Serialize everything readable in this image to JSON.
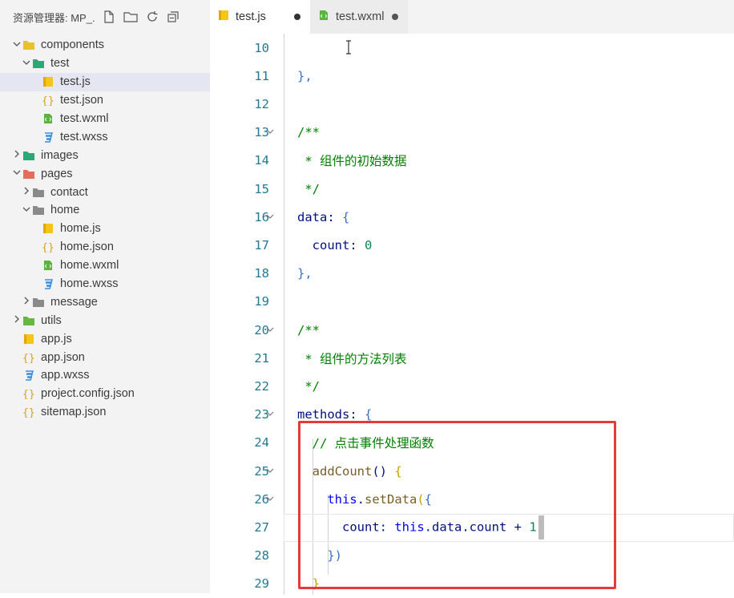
{
  "sidebar": {
    "title": "资源管理器: MP_...",
    "items": [
      {
        "label": "components",
        "type": "folder",
        "open": true,
        "icon": "components-folder-icon",
        "color": "#e8c22a"
      },
      {
        "label": "test",
        "type": "folder",
        "open": true,
        "icon": "test-folder-icon",
        "color": "#2aa876"
      },
      {
        "label": "test.js",
        "type": "js",
        "icon": "js-file-icon",
        "selected": true
      },
      {
        "label": "test.json",
        "type": "json",
        "icon": "json-file-icon"
      },
      {
        "label": "test.wxml",
        "type": "wxml",
        "icon": "wxml-file-icon"
      },
      {
        "label": "test.wxss",
        "type": "wxss",
        "icon": "wxss-file-icon"
      },
      {
        "label": "images",
        "type": "folder",
        "open": false,
        "icon": "images-folder-icon",
        "color": "#2aa876"
      },
      {
        "label": "pages",
        "type": "folder",
        "open": true,
        "icon": "pages-folder-icon",
        "color": "#e56b5b"
      },
      {
        "label": "contact",
        "type": "folder",
        "open": false,
        "icon": "contact-folder-icon",
        "color": "#8a8a8a"
      },
      {
        "label": "home",
        "type": "folder",
        "open": true,
        "icon": "home-folder-icon",
        "color": "#8a8a8a"
      },
      {
        "label": "home.js",
        "type": "js",
        "icon": "js-file-icon"
      },
      {
        "label": "home.json",
        "type": "json",
        "icon": "json-file-icon"
      },
      {
        "label": "home.wxml",
        "type": "wxml",
        "icon": "wxml-file-icon"
      },
      {
        "label": "home.wxss",
        "type": "wxss",
        "icon": "wxss-file-icon"
      },
      {
        "label": "message",
        "type": "folder",
        "open": false,
        "icon": "message-folder-icon",
        "color": "#8a8a8a"
      },
      {
        "label": "utils",
        "type": "folder",
        "open": false,
        "icon": "utils-folder-icon",
        "color": "#6bb544"
      },
      {
        "label": "app.js",
        "type": "js",
        "icon": "js-file-icon"
      },
      {
        "label": "app.json",
        "type": "json",
        "icon": "json-file-icon"
      },
      {
        "label": "app.wxss",
        "type": "wxss",
        "icon": "wxss-file-icon"
      },
      {
        "label": "project.config.json",
        "type": "json",
        "icon": "json-file-icon"
      },
      {
        "label": "sitemap.json",
        "type": "json",
        "icon": "json-file-icon"
      }
    ]
  },
  "tabs": [
    {
      "label": "test.js",
      "active": true,
      "dirty": true
    },
    {
      "label": "test.wxml",
      "active": false,
      "dirty": true
    }
  ],
  "editor": {
    "lines": [
      {
        "n": "10",
        "fold": false,
        "parts": []
      },
      {
        "n": "11",
        "fold": false,
        "parts": [
          {
            "t": "},",
            "c": "punc"
          }
        ]
      },
      {
        "n": "12",
        "fold": false,
        "parts": []
      },
      {
        "n": "13",
        "fold": true,
        "parts": [
          {
            "t": "/**",
            "c": "comment"
          }
        ]
      },
      {
        "n": "14",
        "fold": false,
        "parts": [
          {
            "t": " * 组件的初始数据",
            "c": "comment"
          }
        ]
      },
      {
        "n": "15",
        "fold": false,
        "parts": [
          {
            "t": " */",
            "c": "comment"
          }
        ]
      },
      {
        "n": "16",
        "fold": true,
        "parts": [
          {
            "t": "data",
            "c": "key"
          },
          {
            "t": ": ",
            "c": "key"
          },
          {
            "t": "{",
            "c": "punc"
          }
        ]
      },
      {
        "n": "17",
        "fold": false,
        "parts": [
          {
            "t": "  count",
            "c": "key"
          },
          {
            "t": ": ",
            "c": "key"
          },
          {
            "t": "0",
            "c": "num"
          }
        ]
      },
      {
        "n": "18",
        "fold": false,
        "parts": [
          {
            "t": "},",
            "c": "punc"
          }
        ]
      },
      {
        "n": "19",
        "fold": false,
        "parts": []
      },
      {
        "n": "20",
        "fold": true,
        "parts": [
          {
            "t": "/**",
            "c": "comment"
          }
        ]
      },
      {
        "n": "21",
        "fold": false,
        "parts": [
          {
            "t": " * 组件的方法列表",
            "c": "comment"
          }
        ]
      },
      {
        "n": "22",
        "fold": false,
        "parts": [
          {
            "t": " */",
            "c": "comment"
          }
        ]
      },
      {
        "n": "23",
        "fold": true,
        "parts": [
          {
            "t": "methods",
            "c": "key"
          },
          {
            "t": ": ",
            "c": "key"
          },
          {
            "t": "{",
            "c": "punc"
          }
        ]
      },
      {
        "n": "24",
        "fold": false,
        "parts": [
          {
            "t": "  // 点击事件处理函数",
            "c": "comment"
          }
        ]
      },
      {
        "n": "25",
        "fold": true,
        "parts": [
          {
            "t": "  addCount",
            "c": "fn"
          },
          {
            "t": "() ",
            "c": "key"
          },
          {
            "t": "{",
            "c": "yellow"
          }
        ]
      },
      {
        "n": "26",
        "fold": true,
        "parts": [
          {
            "t": "    this",
            "c": "this"
          },
          {
            "t": ".",
            "c": "key"
          },
          {
            "t": "setData",
            "c": "fn"
          },
          {
            "t": "(",
            "c": "yellow"
          },
          {
            "t": "{",
            "c": "punc"
          }
        ]
      },
      {
        "n": "27",
        "fold": false,
        "parts": [
          {
            "t": "      count",
            "c": "key"
          },
          {
            "t": ": ",
            "c": "key"
          },
          {
            "t": "this",
            "c": "this"
          },
          {
            "t": ".data.count + ",
            "c": "key"
          },
          {
            "t": "1",
            "c": "num"
          }
        ],
        "cursor": true
      },
      {
        "n": "28",
        "fold": false,
        "parts": [
          {
            "t": "    })",
            "c": "punc"
          }
        ]
      },
      {
        "n": "29",
        "fold": false,
        "parts": [
          {
            "t": "  }",
            "c": "yellow"
          }
        ]
      }
    ]
  }
}
